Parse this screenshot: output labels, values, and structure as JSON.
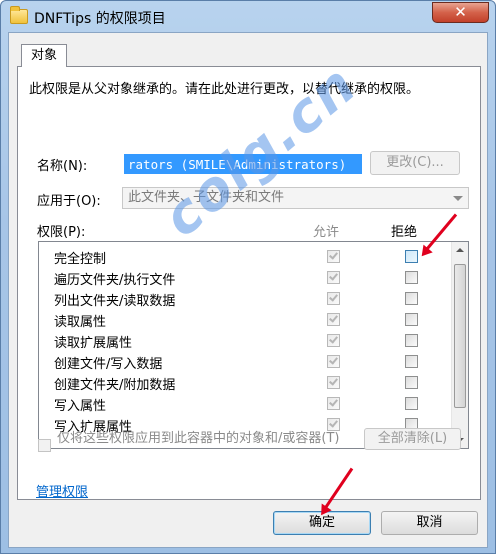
{
  "window": {
    "title": "DNFTips 的权限项目",
    "close_glyph": "✕"
  },
  "tab": {
    "label": "对象"
  },
  "note": "此权限是从父对象继承的。请在此处进行更改，以替代继承的权限。",
  "name": {
    "label": "名称(N):",
    "value": "rators (SMILE\\Administrators)",
    "change_button": "更改(C)..."
  },
  "apply_to": {
    "label": "应用于(O):",
    "value": "此文件夹、子文件夹和文件"
  },
  "permissions": {
    "label": "权限(P):",
    "allow_header": "允许",
    "deny_header": "拒绝",
    "items": [
      {
        "name": "完全控制",
        "allow": true,
        "deny": false
      },
      {
        "name": "遍历文件夹/执行文件",
        "allow": true,
        "deny": false
      },
      {
        "name": "列出文件夹/读取数据",
        "allow": true,
        "deny": false
      },
      {
        "name": "读取属性",
        "allow": true,
        "deny": false
      },
      {
        "name": "读取扩展属性",
        "allow": true,
        "deny": false
      },
      {
        "name": "创建文件/写入数据",
        "allow": true,
        "deny": false
      },
      {
        "name": "创建文件夹/附加数据",
        "allow": true,
        "deny": false
      },
      {
        "name": "写入属性",
        "allow": true,
        "deny": false
      },
      {
        "name": "写入扩展属性",
        "allow": true,
        "deny": false
      }
    ]
  },
  "apply_only": {
    "label": "仅将这些权限应用到此容器中的对象和/或容器(T)",
    "checked": false
  },
  "clear_all_button": "全部清除(L)",
  "manage_link": "管理权限",
  "ok_button": "确定",
  "cancel_button": "取消",
  "watermark": "colg.cn",
  "colors": {
    "arrow": "#e0001e",
    "selection": "#3399ff",
    "link": "#0066cc"
  }
}
